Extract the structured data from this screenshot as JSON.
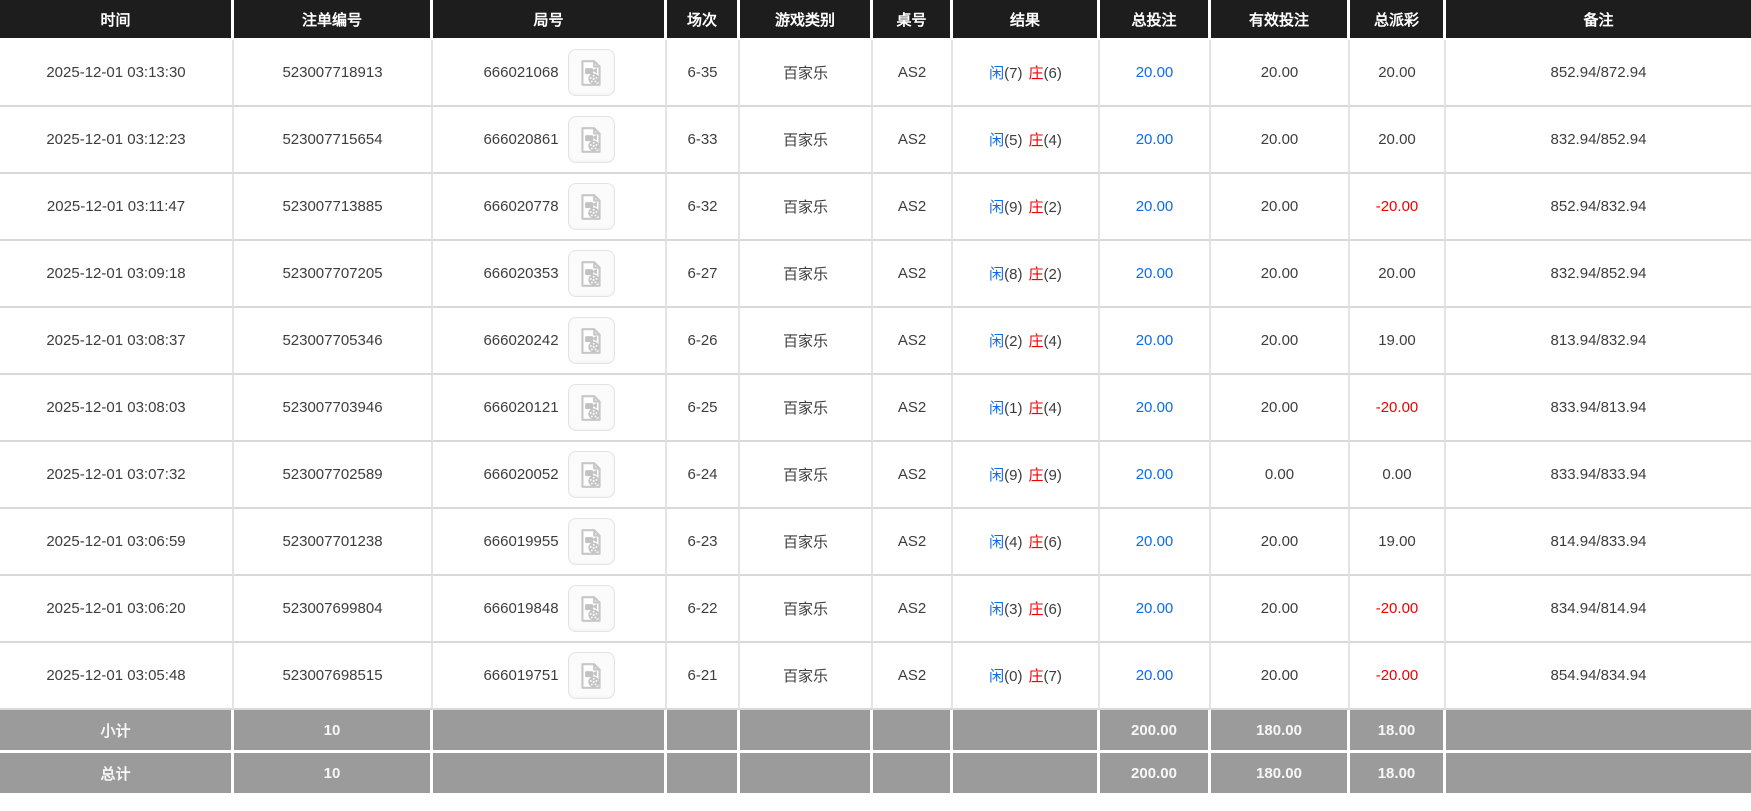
{
  "colors": {
    "accent_blue": "#0b6cf0",
    "negative_red": "#f20000",
    "header_bg": "#1d1d1d",
    "footer_bg": "#9b9b9b"
  },
  "table": {
    "columns": [
      {
        "key": "time",
        "label": "时间"
      },
      {
        "key": "bet_id",
        "label": "注单编号"
      },
      {
        "key": "round",
        "label": "局号"
      },
      {
        "key": "session",
        "label": "场次"
      },
      {
        "key": "game_type",
        "label": "游戏类别"
      },
      {
        "key": "table_no",
        "label": "桌号"
      },
      {
        "key": "result",
        "label": "结果"
      },
      {
        "key": "total_bet",
        "label": "总投注"
      },
      {
        "key": "valid_bet",
        "label": "有效投注"
      },
      {
        "key": "total_payout",
        "label": "总派彩"
      },
      {
        "key": "remark",
        "label": "备注"
      }
    ],
    "video_icon_name": "video-replay-icon",
    "rows": [
      {
        "time": "2025-12-01 03:13:30",
        "bet_id": "523007718913",
        "round": "666021068",
        "session": "6-35",
        "game_type": "百家乐",
        "table_no": "AS2",
        "result": {
          "player": "闲",
          "player_score": "(7)",
          "banker": "庄",
          "banker_score": "(6)"
        },
        "total_bet": "20.00",
        "valid_bet": "20.00",
        "total_payout": "20.00",
        "remark": "852.94/872.94"
      },
      {
        "time": "2025-12-01 03:12:23",
        "bet_id": "523007715654",
        "round": "666020861",
        "session": "6-33",
        "game_type": "百家乐",
        "table_no": "AS2",
        "result": {
          "player": "闲",
          "player_score": "(5)",
          "banker": "庄",
          "banker_score": "(4)"
        },
        "total_bet": "20.00",
        "valid_bet": "20.00",
        "total_payout": "20.00",
        "remark": "832.94/852.94"
      },
      {
        "time": "2025-12-01 03:11:47",
        "bet_id": "523007713885",
        "round": "666020778",
        "session": "6-32",
        "game_type": "百家乐",
        "table_no": "AS2",
        "result": {
          "player": "闲",
          "player_score": "(9)",
          "banker": "庄",
          "banker_score": "(2)"
        },
        "total_bet": "20.00",
        "valid_bet": "20.00",
        "total_payout": "-20.00",
        "remark": "852.94/832.94"
      },
      {
        "time": "2025-12-01 03:09:18",
        "bet_id": "523007707205",
        "round": "666020353",
        "session": "6-27",
        "game_type": "百家乐",
        "table_no": "AS2",
        "result": {
          "player": "闲",
          "player_score": "(8)",
          "banker": "庄",
          "banker_score": "(2)"
        },
        "total_bet": "20.00",
        "valid_bet": "20.00",
        "total_payout": "20.00",
        "remark": "832.94/852.94"
      },
      {
        "time": "2025-12-01 03:08:37",
        "bet_id": "523007705346",
        "round": "666020242",
        "session": "6-26",
        "game_type": "百家乐",
        "table_no": "AS2",
        "result": {
          "player": "闲",
          "player_score": "(2)",
          "banker": "庄",
          "banker_score": "(4)"
        },
        "total_bet": "20.00",
        "valid_bet": "20.00",
        "total_payout": "19.00",
        "remark": "813.94/832.94"
      },
      {
        "time": "2025-12-01 03:08:03",
        "bet_id": "523007703946",
        "round": "666020121",
        "session": "6-25",
        "game_type": "百家乐",
        "table_no": "AS2",
        "result": {
          "player": "闲",
          "player_score": "(1)",
          "banker": "庄",
          "banker_score": "(4)"
        },
        "total_bet": "20.00",
        "valid_bet": "20.00",
        "total_payout": "-20.00",
        "remark": "833.94/813.94"
      },
      {
        "time": "2025-12-01 03:07:32",
        "bet_id": "523007702589",
        "round": "666020052",
        "session": "6-24",
        "game_type": "百家乐",
        "table_no": "AS2",
        "result": {
          "player": "闲",
          "player_score": "(9)",
          "banker": "庄",
          "banker_score": "(9)"
        },
        "total_bet": "20.00",
        "valid_bet": "0.00",
        "total_payout": "0.00",
        "remark": "833.94/833.94"
      },
      {
        "time": "2025-12-01 03:06:59",
        "bet_id": "523007701238",
        "round": "666019955",
        "session": "6-23",
        "game_type": "百家乐",
        "table_no": "AS2",
        "result": {
          "player": "闲",
          "player_score": "(4)",
          "banker": "庄",
          "banker_score": "(6)"
        },
        "total_bet": "20.00",
        "valid_bet": "20.00",
        "total_payout": "19.00",
        "remark": "814.94/833.94"
      },
      {
        "time": "2025-12-01 03:06:20",
        "bet_id": "523007699804",
        "round": "666019848",
        "session": "6-22",
        "game_type": "百家乐",
        "table_no": "AS2",
        "result": {
          "player": "闲",
          "player_score": "(3)",
          "banker": "庄",
          "banker_score": "(6)"
        },
        "total_bet": "20.00",
        "valid_bet": "20.00",
        "total_payout": "-20.00",
        "remark": "834.94/814.94"
      },
      {
        "time": "2025-12-01 03:05:48",
        "bet_id": "523007698515",
        "round": "666019751",
        "session": "6-21",
        "game_type": "百家乐",
        "table_no": "AS2",
        "result": {
          "player": "闲",
          "player_score": "(0)",
          "banker": "庄",
          "banker_score": "(7)"
        },
        "total_bet": "20.00",
        "valid_bet": "20.00",
        "total_payout": "-20.00",
        "remark": "854.94/834.94"
      }
    ],
    "footer": {
      "subtotal": [
        "小计",
        "10",
        "",
        "",
        "",
        "",
        "",
        "200.00",
        "180.00",
        "18.00",
        ""
      ],
      "grand_total": [
        "总计",
        "10",
        "",
        "",
        "",
        "",
        "",
        "200.00",
        "180.00",
        "18.00",
        ""
      ]
    }
  }
}
